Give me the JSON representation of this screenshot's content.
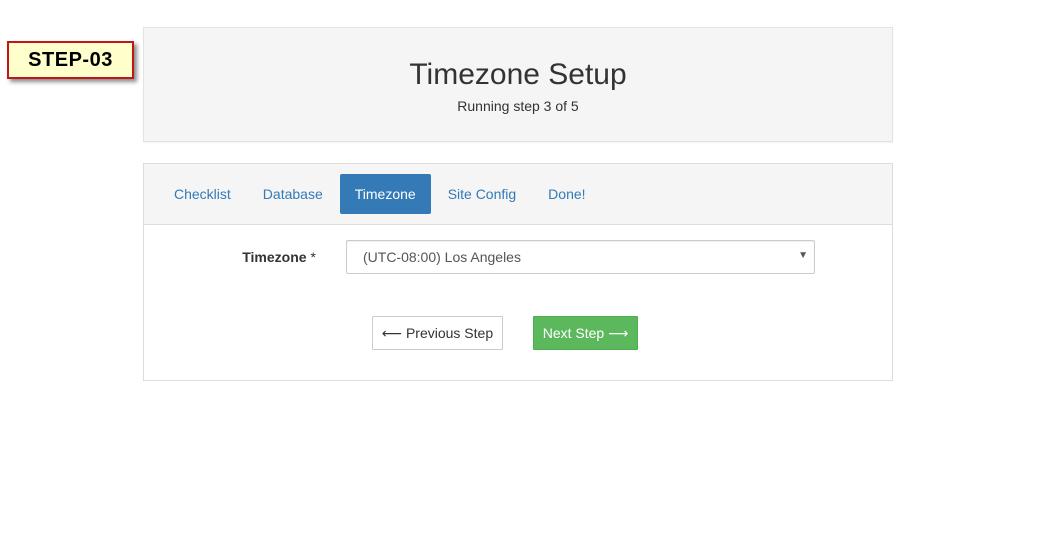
{
  "step_badge": "STEP-03",
  "header": {
    "title": "Timezone Setup",
    "subtitle": "Running step 3 of 5"
  },
  "tabs": [
    {
      "label": "Checklist",
      "active": false
    },
    {
      "label": "Database",
      "active": false
    },
    {
      "label": "Timezone",
      "active": true
    },
    {
      "label": "Site Config",
      "active": false
    },
    {
      "label": "Done!",
      "active": false
    }
  ],
  "form": {
    "timezone_label": "Timezone",
    "required_mark": "*",
    "timezone_value": "(UTC-08:00) Los Angeles",
    "dropdown_arrow": "▼"
  },
  "buttons": {
    "prev_arrow": "⟵",
    "prev_label": "Previous Step",
    "next_label": "Next Step",
    "next_arrow": "⟶"
  },
  "colors": {
    "accent": "#337ab7",
    "success": "#5cb85c",
    "badge_border": "#c0161a",
    "badge_bg": "#ffffcc"
  }
}
